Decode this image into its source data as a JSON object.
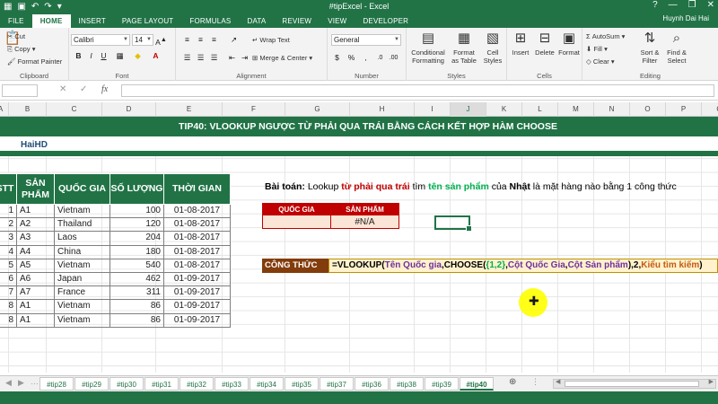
{
  "window": {
    "title": "#tipExcel - Excel",
    "user": "Huynh Dai Hai"
  },
  "ribbon_tabs": [
    "FILE",
    "HOME",
    "INSERT",
    "PAGE LAYOUT",
    "FORMULAS",
    "DATA",
    "REVIEW",
    "VIEW",
    "DEVELOPER"
  ],
  "active_tab": "HOME",
  "ribbon": {
    "clipboard": {
      "label": "Clipboard",
      "paste": "Paste",
      "cut": "Cut",
      "copy": "Copy",
      "format_painter": "Format Painter"
    },
    "font": {
      "label": "Font",
      "name": "Calibri",
      "size": "14"
    },
    "alignment": {
      "label": "Alignment",
      "wrap_text": "Wrap Text",
      "merge_center": "Merge & Center"
    },
    "number": {
      "label": "Number",
      "format": "General"
    },
    "styles": {
      "label": "Styles",
      "conditional": "Conditional Formatting",
      "format_table": "Format as Table",
      "cell_styles": "Cell Styles"
    },
    "cells": {
      "label": "Cells",
      "insert": "Insert",
      "delete": "Delete",
      "format": "Format"
    },
    "editing": {
      "label": "Editing",
      "autosum": "AutoSum",
      "fill": "Fill",
      "clear": "Clear",
      "sort_filter": "Sort & Filter",
      "find_select": "Find & Select"
    }
  },
  "formula_bar": {
    "fx": "fx"
  },
  "columns": [
    "A",
    "B",
    "C",
    "D",
    "E",
    "F",
    "G",
    "H",
    "I",
    "J",
    "K",
    "L",
    "M",
    "N",
    "O",
    "P",
    "Q"
  ],
  "selected_column": "J",
  "banner": "TIP40: VLOOKUP NGƯỢC TỪ PHẢI QUA TRÁI BẰNG CÁCH KẾT HỢP HÀM CHOOSE",
  "author": "HaiHD",
  "table": {
    "headers": [
      "STT",
      "SẢN PHẨM",
      "QUỐC GIA",
      "SỐ LƯỢNG",
      "THỜI GIAN"
    ],
    "rows": [
      [
        "1",
        "A1",
        "Vietnam",
        "100",
        "01-08-2017"
      ],
      [
        "2",
        "A2",
        "Thailand",
        "120",
        "01-08-2017"
      ],
      [
        "3",
        "A3",
        "Laos",
        "204",
        "01-08-2017"
      ],
      [
        "4",
        "A4",
        "China",
        "180",
        "01-08-2017"
      ],
      [
        "5",
        "A5",
        "Vietnam",
        "540",
        "01-08-2017"
      ],
      [
        "6",
        "A6",
        "Japan",
        "462",
        "01-09-2017"
      ],
      [
        "7",
        "A7",
        "France",
        "311",
        "01-09-2017"
      ],
      [
        "8",
        "A1",
        "Vietnam",
        "86",
        "01-09-2017"
      ],
      [
        "8",
        "A1",
        "Vietnam",
        "86",
        "01-09-2017"
      ]
    ]
  },
  "problem": {
    "p1": "Bài toán:",
    "p2": " Lookup ",
    "p3": "từ phải qua trái",
    "p4": " tìm ",
    "p5": "tên sản phẩm",
    "p6": " của ",
    "p7": "Nhật",
    "p8": " là mặt hàng nào bằng 1 công thức"
  },
  "lookup": {
    "h1": "QUỐC GIA",
    "h2": "SẢN PHẨM",
    "v1": "",
    "v2": "#N/A"
  },
  "formula": {
    "label": "CÔNG THỨC",
    "f1": "=VLOOKUP(",
    "f2": "Tên Quốc gia",
    "f3": ",CHOOSE(",
    "f4": "{1,2}",
    "f5": ",",
    "f6": "Cột Quốc Gia",
    "f7": ",",
    "f8": "Cột Sản phẩm",
    "f9": "),2,",
    "f10": "Kiểu tìm kiếm",
    "f11": ")"
  },
  "sheet_tabs": [
    "#tip28",
    "#tip29",
    "#tip30",
    "#tip31",
    "#tip32",
    "#tip33",
    "#tip34",
    "#tip35",
    "#tip37",
    "#tip36",
    "#tip38",
    "#tip39",
    "#tip40"
  ],
  "active_sheet": "#tip40",
  "colors": {
    "excel_green": "#217346",
    "accent_red": "#c00000",
    "formula_label": "#833c0c"
  }
}
